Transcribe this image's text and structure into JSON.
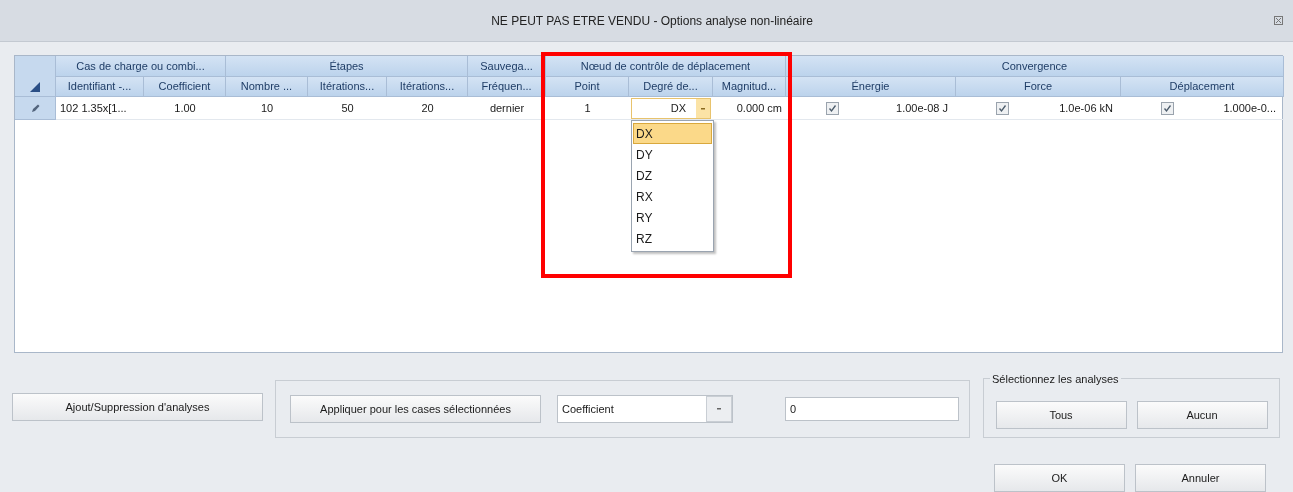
{
  "window": {
    "title": "NE PEUT PAS ETRE VENDU - Options analyse non-linéaire"
  },
  "grid": {
    "groups": [
      {
        "label": "Cas de charge ou combi...",
        "columns": [
          {
            "label": "Identifiant -...",
            "kind": "text"
          },
          {
            "label": "Coefficient",
            "kind": "text"
          }
        ]
      },
      {
        "label": "Étapes",
        "columns": [
          {
            "label": "Nombre ...",
            "kind": "text"
          },
          {
            "label": "Itérations...",
            "kind": "text"
          },
          {
            "label": "Itérations...",
            "kind": "text"
          }
        ]
      },
      {
        "label": "Sauvega...",
        "columns": [
          {
            "label": "Fréquen...",
            "kind": "text"
          }
        ]
      },
      {
        "label": "Nœud de contrôle de déplacement",
        "columns": [
          {
            "label": "Point",
            "kind": "text"
          },
          {
            "label": "Degré de...",
            "kind": "dropdown"
          },
          {
            "label": "Magnitud...",
            "kind": "text"
          }
        ]
      },
      {
        "label": "Convergence",
        "columns": [
          {
            "label": "Énergie",
            "kind": "check"
          },
          {
            "label": "Force",
            "kind": "check"
          },
          {
            "label": "Déplacement",
            "kind": "check"
          }
        ]
      }
    ],
    "rows": [
      {
        "editing": true,
        "cells": [
          {
            "text": "102 1.35x[1..."
          },
          {
            "text": "1.00"
          },
          {
            "text": "10"
          },
          {
            "text": "50"
          },
          {
            "text": "20"
          },
          {
            "text": "dernier"
          },
          {
            "text": "1"
          },
          {
            "text": "DX",
            "expanded": true,
            "options": [
              {
                "label": "DX",
                "selected": true
              },
              {
                "label": "DY",
                "selected": false
              },
              {
                "label": "DZ",
                "selected": false
              },
              {
                "label": "RX",
                "selected": false
              },
              {
                "label": "RY",
                "selected": false
              },
              {
                "label": "RZ",
                "selected": false
              }
            ]
          },
          {
            "text": "0.000 cm"
          },
          {
            "checked": true,
            "text": "1.00e-08 J"
          },
          {
            "checked": true,
            "text": "1.0e-06 kN"
          },
          {
            "checked": true,
            "text": "1.000e-0..."
          }
        ]
      }
    ]
  },
  "add_remove_button": "Ajout/Suppression d'analyses",
  "apply_group": {
    "button": "Appliquer pour les cases sélectionnées",
    "combo_value": "Coefficient",
    "value": "0"
  },
  "select_group": {
    "title": "Sélectionnez les analyses",
    "buttons": [
      "Tous",
      "Aucun"
    ]
  },
  "footer_buttons": [
    "OK",
    "Annuler"
  ]
}
